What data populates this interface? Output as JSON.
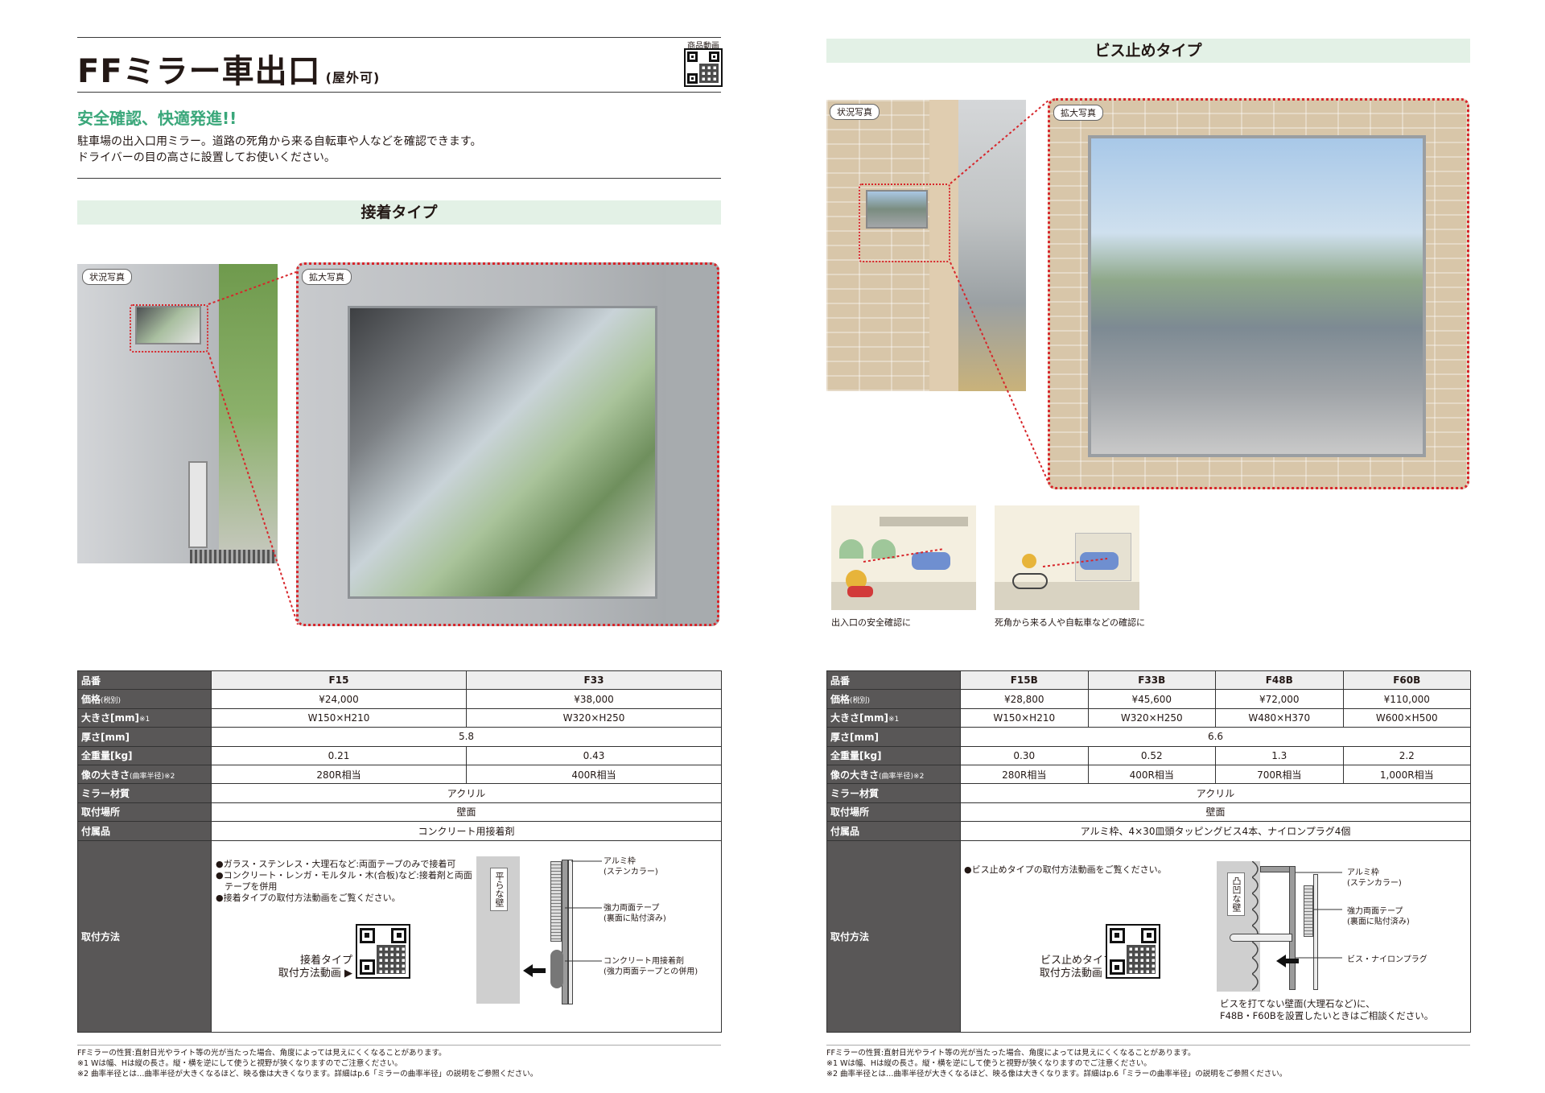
{
  "left_page": {
    "title": "FFミラー車出口",
    "title_suffix": "(屋外可)",
    "qr_caption": "商品動画",
    "catch_copy": "安全確認、快適発進!!",
    "description": [
      "駐車場の出入口用ミラー。道路の死角から来る自転車や人などを確認できます。",
      "ドライバーの目の高さに設置してお使いください。"
    ],
    "section_title": "接着タイプ",
    "tag_situation": "状況写真",
    "tag_zoom": "拡大写真",
    "spec": {
      "labels": [
        "品番",
        "価格",
        "大きさ[mm]",
        "厚さ[mm]",
        "全重量[kg]",
        "像の大きさ",
        "ミラー材質",
        "取付場所",
        "付属品",
        "取付方法"
      ],
      "price_note": "(税別)",
      "size_note": "※1",
      "image_note": "(曲率半径)※2",
      "columns": [
        "F15",
        "F33"
      ],
      "price": [
        "¥24,000",
        "¥38,000"
      ],
      "size": [
        "W150×H210",
        "W320×H250"
      ],
      "thickness": "5.8",
      "weight": [
        "0.21",
        "0.43"
      ],
      "image_size": [
        "280R相当",
        "400R相当"
      ],
      "material": "アクリル",
      "location": "壁面",
      "accessory": "コンクリート用接着剤"
    },
    "method_notes": [
      "●ガラス・ステンレス・大理石など:両面テープのみで接着可",
      "●コンクリート・レンガ・モルタル・木(合板)など:接着剤と両面",
      "　テープを併用",
      "●接着タイプの取付方法動画をご覧ください。"
    ],
    "qr_label": [
      "接着タイプ",
      "取付方法動画 ▶"
    ],
    "wall_label": "平らな壁",
    "callouts": [
      "アルミ枠",
      "(ステンカラー)",
      "強力両面テープ",
      "(裏面に貼付済み)",
      "コンクリート用接着剤",
      "(強力両面テープとの併用)"
    ],
    "footnotes": [
      "FFミラーの性質:直射日光やライト等の光が当たった場合、角度によっては見えにくくなることがあります。",
      "※1 Wは幅、Hは縦の長さ。縦・横を逆にして使うと視野が狭くなりますのでご注意ください。",
      "※2 曲率半径とは…曲率半径が大きくなるほど、映る像は大きくなります。詳細はp.6「ミラーの曲率半径」の説明をご参照ください。"
    ]
  },
  "right_page": {
    "section_title": "ビス止めタイプ",
    "tag_situation": "状況写真",
    "tag_zoom": "拡大写真",
    "illustration_captions": [
      "出入口の安全確認に",
      "死角から来る人や自転車などの確認に"
    ],
    "spec": {
      "labels": [
        "品番",
        "価格",
        "大きさ[mm]",
        "厚さ[mm]",
        "全重量[kg]",
        "像の大きさ",
        "ミラー材質",
        "取付場所",
        "付属品",
        "取付方法"
      ],
      "price_note": "(税別)",
      "size_note": "※1",
      "image_note": "(曲率半径)※2",
      "columns": [
        "F15B",
        "F33B",
        "F48B",
        "F60B"
      ],
      "price": [
        "¥28,800",
        "¥45,600",
        "¥72,000",
        "¥110,000"
      ],
      "size": [
        "W150×H210",
        "W320×H250",
        "W480×H370",
        "W600×H500"
      ],
      "thickness": "6.6",
      "weight": [
        "0.30",
        "0.52",
        "1.3",
        "2.2"
      ],
      "image_size": [
        "280R相当",
        "400R相当",
        "700R相当",
        "1,000R相当"
      ],
      "material": "アクリル",
      "location": "壁面",
      "accessory": "アルミ枠、4×30皿頭タッピングビス4本、ナイロンプラグ4個"
    },
    "method_notes": [
      "●ビス止めタイプの取付方法動画をご覧ください。"
    ],
    "qr_label": [
      "ビス止めタイプ",
      "取付方法動画 ▶"
    ],
    "wall_label": "凸凹な壁",
    "callouts": [
      "アルミ枠",
      "(ステンカラー)",
      "強力両面テープ",
      "(裏面に貼付済み)",
      "ビス・ナイロンプラグ"
    ],
    "bottom_note": [
      "ビスを打てない壁面(大理石など)に、",
      "F48B・F60Bを設置したいときはご相談ください。"
    ],
    "footnotes": [
      "FFミラーの性質:直射日光やライト等の光が当たった場合、角度によっては見えにくくなることがあります。",
      "※1 Wは幅、Hは縦の長さ。縦・横を逆にして使うと視野が狭くなりますのでご注意ください。",
      "※2 曲率半径とは…曲率半径が大きくなるほど、映る像は大きくなります。詳細はp.6「ミラーの曲率半径」の説明をご参照ください。"
    ]
  },
  "colors": {
    "accent_green": "#3aa77a",
    "band_green": "#e3f1e6",
    "label_grey": "#595757",
    "zoom_red": "#d7262b"
  },
  "icons": [
    "qr-code-icon",
    "arrow-left-icon"
  ]
}
